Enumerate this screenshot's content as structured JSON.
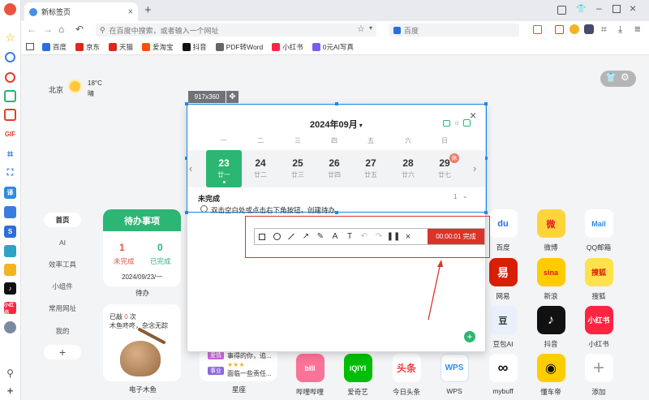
{
  "tab": {
    "title": "新标签页",
    "close": "×",
    "new": "+"
  },
  "omnibox": {
    "placeholder": "在百度中搜索，或者输入一个网址"
  },
  "search_box": {
    "placeholder": "百度"
  },
  "bookmarks": [
    {
      "label": "百度",
      "color": "#2b6de0"
    },
    {
      "label": "京东",
      "color": "#e1251b"
    },
    {
      "label": "天猫",
      "color": "#e1251b"
    },
    {
      "label": "爱淘宝",
      "color": "#ff5000"
    },
    {
      "label": "抖音",
      "color": "#111111"
    },
    {
      "label": "PDF转Word",
      "color": "#666666"
    },
    {
      "label": "小红书",
      "color": "#ff2442"
    },
    {
      "label": "0元AI写真",
      "color": "#7a5af8"
    }
  ],
  "weather": {
    "city": "北京",
    "temp": "18°C",
    "desc": "晴"
  },
  "left_nav": [
    "首页",
    "AI",
    "效率工具",
    "小组件",
    "常用网址",
    "我的"
  ],
  "left_nav_add": "+",
  "todo": {
    "title": "待办事项",
    "pending_count": "1",
    "pending_label": "未完成",
    "done_count": "0",
    "done_label": "已完成",
    "date": "2024/09/23/一",
    "caption": "待办"
  },
  "muyu": {
    "line1_prefix": "已敲 ",
    "count": "0",
    "line1_suffix": " 次",
    "line2": "木鱼咚咚，杂念无踪",
    "caption": "电子木鱼"
  },
  "xingzuo": {
    "tag1": "爱情",
    "text1": "事得的你，追...",
    "tag2": "事业",
    "stars": "★★★",
    "text2": "面临一些责任...",
    "caption": "星座"
  },
  "dims_badge": "917x360",
  "calendar": {
    "month": "2024年09月",
    "weekdays": [
      "一",
      "二",
      "三",
      "四",
      "五",
      "六",
      "日"
    ],
    "days": [
      {
        "d": "23",
        "lunar": "廿一"
      },
      {
        "d": "24",
        "lunar": "廿二"
      },
      {
        "d": "25",
        "lunar": "廿三"
      },
      {
        "d": "26",
        "lunar": "廿四"
      },
      {
        "d": "27",
        "lunar": "廿五"
      },
      {
        "d": "28",
        "lunar": "廿六"
      },
      {
        "d": "29",
        "lunar": "廿七"
      }
    ],
    "rest_badge": "休",
    "section": "未完成",
    "count": "1",
    "todo_hint": "双击空白处或点击右下角按钮，创建待办",
    "add": "+"
  },
  "toolbar": {
    "time": "00:00:01",
    "done": "完成"
  },
  "apps": [
    {
      "label": "百度",
      "bg": "#ffffff",
      "fg": "#2b6de0",
      "glyph": "du"
    },
    {
      "label": "微博",
      "bg": "#ffd43b",
      "fg": "#e6162d",
      "glyph": "微"
    },
    {
      "label": "QQ邮箱",
      "bg": "#ffffff",
      "fg": "#2b8ae6",
      "glyph": "Mail"
    },
    {
      "label": "网易",
      "bg": "#d81e06",
      "fg": "#ffffff",
      "glyph": "易"
    },
    {
      "label": "新浪",
      "bg": "#ffcc00",
      "fg": "#d81e06",
      "glyph": "sina"
    },
    {
      "label": "搜狐",
      "bg": "#ffe14d",
      "fg": "#d81e06",
      "glyph": "搜狐"
    },
    {
      "label": "豆包AI",
      "bg": "#e9f0fb",
      "fg": "#333333",
      "glyph": "豆"
    },
    {
      "label": "抖音",
      "bg": "#111111",
      "fg": "#ffffff",
      "glyph": "♪"
    },
    {
      "label": "小红书",
      "bg": "#ff2442",
      "fg": "#ffffff",
      "glyph": "小红书"
    },
    {
      "label": "mybuff",
      "bg": "#ffffff",
      "fg": "#111111",
      "glyph": "∞"
    },
    {
      "label": "懂车帝",
      "bg": "#ffcc00",
      "fg": "#111111",
      "glyph": "◉"
    },
    {
      "label": "添加",
      "bg": "#ffffff",
      "fg": "#999999",
      "glyph": "+"
    },
    {
      "label": "哔哩哔哩",
      "bg": "#fb7299",
      "fg": "#ffffff",
      "glyph": "bili"
    },
    {
      "label": "爱奇艺",
      "bg": "#00be06",
      "fg": "#ffffff",
      "glyph": "iQIYI"
    },
    {
      "label": "今日头条",
      "bg": "#ffffff",
      "fg": "#ed4040",
      "glyph": "头条"
    },
    {
      "label": "WPS",
      "bg": "#ffffff",
      "fg": "#2c8fe6",
      "glyph": "WPS"
    }
  ],
  "colors": {
    "accent_green": "#2bb673",
    "record_red": "#d9342b",
    "selection_blue": "#1e88e5"
  }
}
